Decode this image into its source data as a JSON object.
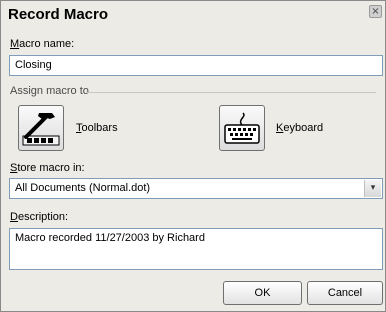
{
  "dialog": {
    "title": "Record Macro",
    "close_glyph": "×"
  },
  "macro_name": {
    "label_prefix": "",
    "label_mnemonic": "M",
    "label_rest": "acro name:",
    "value": "Closing"
  },
  "assign": {
    "group_label": "Assign macro to",
    "toolbars": {
      "icon": "toolbar-hammer-icon",
      "label_mnemonic": "T",
      "label_rest": "oolbars"
    },
    "keyboard": {
      "icon": "keyboard-icon",
      "label_mnemonic": "K",
      "label_rest": "eyboard"
    }
  },
  "store_in": {
    "label_mnemonic": "S",
    "label_rest": "tore macro in:",
    "selected": "All Documents (Normal.dot)",
    "arrow_glyph": "▾"
  },
  "description": {
    "label_mnemonic": "D",
    "label_rest": "escription:",
    "value": "Macro recorded 11/27/2003 by Richard"
  },
  "buttons": {
    "ok": "OK",
    "cancel": "Cancel"
  }
}
